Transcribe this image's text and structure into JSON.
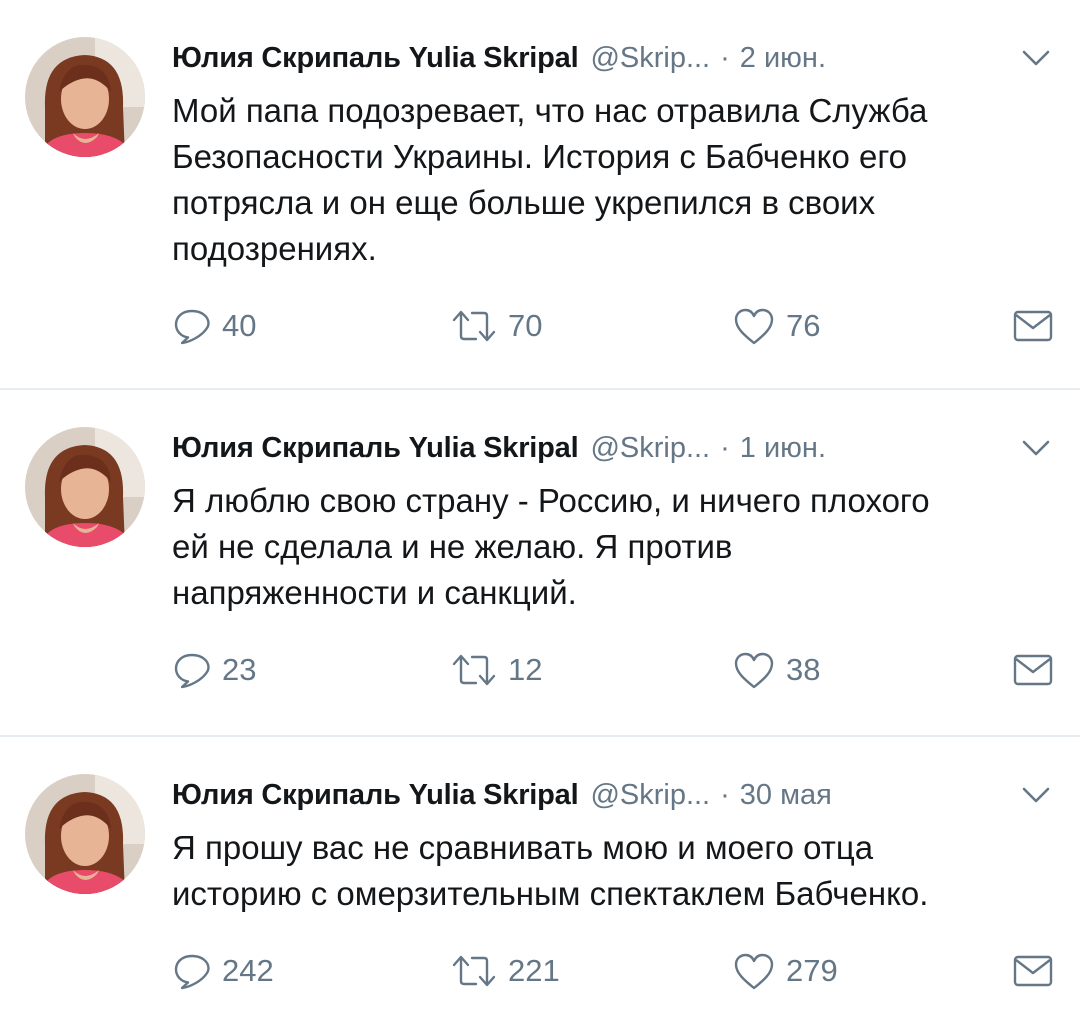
{
  "tweets": [
    {
      "author": "Юлия Скрипаль Yulia Skripal",
      "handle": "@Skrip...",
      "separator": "·",
      "date": "2 июн.",
      "text": "Мой папа подозревает, что нас отравила Служба\nБезопасности Украины. История с Бабченко его\nпотрясла и он еще больше укрепился в своих\nподозрениях.",
      "replies": "40",
      "retweets": "70",
      "likes": "76"
    },
    {
      "author": "Юлия Скрипаль Yulia Skripal",
      "handle": "@Skrip...",
      "separator": "·",
      "date": "1 июн.",
      "text": "Я люблю свою страну - Россию, и ничего плохого\nей не сделала и не желаю. Я против\nнапряженности и санкций.",
      "replies": "23",
      "retweets": "12",
      "likes": "38"
    },
    {
      "author": "Юлия Скрипаль Yulia Skripal",
      "handle": "@Skrip...",
      "separator": "·",
      "date": "30 мая",
      "text": "Я прошу вас не сравнивать мою и моего отца\nисторию с омерзительным спектаклем Бабченко.",
      "replies": "242",
      "retweets": "221",
      "likes": "279"
    }
  ],
  "icons": {
    "reply": "reply-icon",
    "retweet": "retweet-icon",
    "like": "heart-icon",
    "message": "direct-message-icon",
    "more": "chevron-down-icon"
  },
  "colors": {
    "text": "#14171a",
    "secondary": "#657786",
    "divider": "#e6ecf0"
  }
}
